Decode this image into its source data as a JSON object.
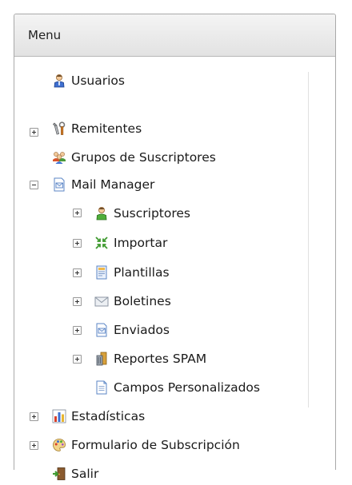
{
  "menu": {
    "title": "Menu",
    "items": [
      {
        "label": "Usuarios",
        "icon": "user-blue-icon",
        "toggle": "none",
        "level": 0
      },
      {
        "label": "Remitentes",
        "icon": "tools-icon",
        "toggle": "plus",
        "level": 0
      },
      {
        "label": "Grupos de Suscriptores",
        "icon": "group-users-icon",
        "toggle": "none",
        "level": 0
      },
      {
        "label": "Mail Manager",
        "icon": "mail-document-icon",
        "toggle": "minus",
        "level": 0
      },
      {
        "label": "Suscriptores",
        "icon": "user-green-icon",
        "toggle": "plus",
        "level": 1
      },
      {
        "label": "Importar",
        "icon": "import-arrows-icon",
        "toggle": "plus",
        "level": 1
      },
      {
        "label": "Plantillas",
        "icon": "template-icon",
        "toggle": "plus",
        "level": 1
      },
      {
        "label": "Boletines",
        "icon": "envelope-icon",
        "toggle": "plus",
        "level": 1
      },
      {
        "label": "Enviados",
        "icon": "mail-document-icon",
        "toggle": "plus",
        "level": 1
      },
      {
        "label": "Reportes SPAM",
        "icon": "trash-bin-icon",
        "toggle": "plus",
        "level": 1
      },
      {
        "label": "Campos Personalizados",
        "icon": "document-icon",
        "toggle": "none",
        "level": 1
      },
      {
        "label": "Estadísticas",
        "icon": "bar-chart-icon",
        "toggle": "plus",
        "level": 0
      },
      {
        "label": "Formulario de Subscripción",
        "icon": "palette-icon",
        "toggle": "plus",
        "level": 0
      },
      {
        "label": "Salir",
        "icon": "exit-door-icon",
        "toggle": "none",
        "level": 0
      }
    ]
  }
}
